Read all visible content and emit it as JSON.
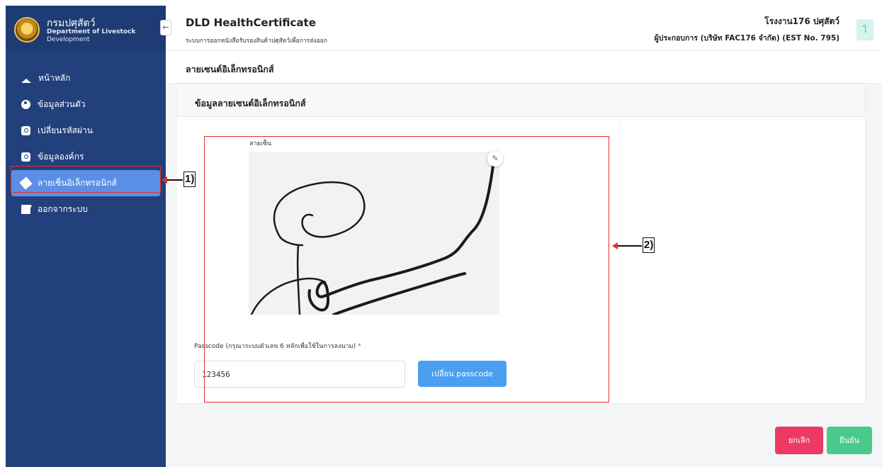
{
  "sidebar": {
    "dept_th": "กรมปศุสัตว์",
    "dept_en_line1": "Department of Livestock",
    "dept_en_line2": "Development",
    "collapse_icon": "←",
    "items": [
      {
        "label": "หน้าหลัก",
        "icon": "home-icon"
      },
      {
        "label": "ข้อมูลส่วนตัว",
        "icon": "user-icon"
      },
      {
        "label": "เปลี่ยนรหัสผ่าน",
        "icon": "key-icon"
      },
      {
        "label": "ข้อมูลองค์กร",
        "icon": "building-icon"
      },
      {
        "label": "ลายเซ็นอิเล็กทรอนิกส์",
        "icon": "pen-icon",
        "active": true
      },
      {
        "label": "ออกจากระบบ",
        "icon": "logout-icon"
      }
    ]
  },
  "header": {
    "title": "DLD HealthCertificate",
    "subtitle": "ระบบการออกหนังสือรับรองสินค้าปศุสัตว์เพื่อการส่งออก",
    "user_line1": "โรงงาน176 ปศุสัตว์",
    "user_line2": "ผู้ประกอบการ (บริษัท FAC176 จำกัด) (EST No. 795)",
    "avatar_letter": "โ"
  },
  "page": {
    "title": "ลายเซนต์อิเล็กทรอนิกส์"
  },
  "card": {
    "title": "ข้อมูลลายเซนต์อิเล็กทรอนิกส์",
    "signature_label": "ลายเซ็น",
    "edit_icon": "✎",
    "passcode_label": "Passcode (กรุณาระบบตัวเลข 6 หลักเพื่อใช้ในการลงนาม)",
    "required_mark": "*",
    "passcode_value": "123456",
    "change_button": "เปลี่ยน passcode"
  },
  "footer": {
    "cancel_button": "ยกเลิก",
    "confirm_button": "ยืนยัน"
  },
  "annotations": {
    "label_1": "1)",
    "label_2": "2)"
  },
  "colors": {
    "sidebar": "#22407c",
    "active_item": "#5b8fe6",
    "primary_button": "#4b9ff0",
    "cancel": "#ec3a64",
    "confirm": "#49c98b",
    "annotation": "#e0302a"
  }
}
